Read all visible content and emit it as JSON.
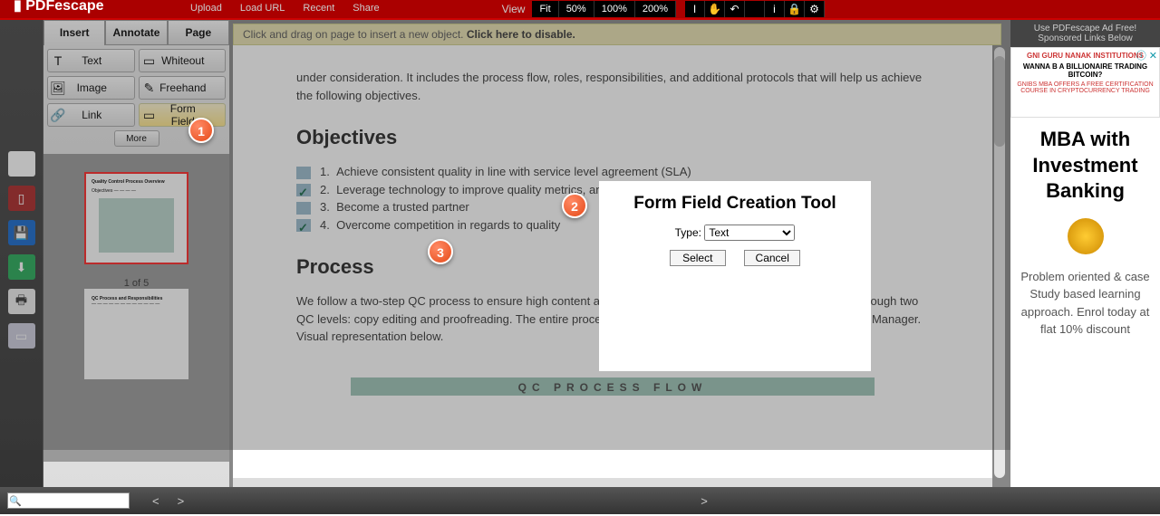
{
  "topbar": {
    "logo": "PDFescape",
    "menu": [
      "Upload",
      "Load URL",
      "Recent",
      "Share"
    ],
    "view_label": "View",
    "zoom": [
      "Fit",
      "50%",
      "100%",
      "200%"
    ],
    "icons": [
      "text-cursor-icon",
      "hand-icon",
      "undo-icon",
      "redo-icon",
      "info-icon",
      "lock-icon",
      "gear-icon"
    ]
  },
  "tabs": {
    "insert": "Insert",
    "annotate": "Annotate",
    "page": "Page"
  },
  "tools": {
    "text": "Text",
    "whiteout": "Whiteout",
    "image": "Image",
    "freehand": "Freehand",
    "link": "Link",
    "formfield": "Form Field",
    "more": "More"
  },
  "thumbs": {
    "page1_label": "1 of 5",
    "page1_title": "Quality Control Process Overview"
  },
  "hint": {
    "pre": "Click and drag on page to insert a new object. ",
    "bold": "Click here to disable."
  },
  "doc": {
    "intro_tail": "under consideration. It includes the process flow, roles, responsibilities, and additional protocols that will help us achieve the following objectives.",
    "h_objectives": "Objectives",
    "obj1": "Achieve consistent quality in line with service level agreement (SLA)",
    "obj2": "Leverage technology to improve quality metrics, and deliver a superior customer experience",
    "obj3": "Become a trusted partner",
    "obj4": "Overcome competition in regards to quality",
    "h_process": "Process",
    "process_para": "We follow a two-step QC process to ensure high content accuracy & consistency. Each writer's work will go through two QC levels: copy editing and proofreading. The entire process will be owned and overseen by a Quality Control Manager. Visual representation below.",
    "qc_banner": "QC PROCESS FLOW"
  },
  "modal": {
    "title": "Form Field Creation Tool",
    "type_label": "Type:",
    "type_value": "Text",
    "select": "Select",
    "cancel": "Cancel"
  },
  "ads": {
    "line1": "Use PDFescape Ad Free!",
    "line2": "Sponsored Links Below",
    "banner_top": "GNI GURU NANAK INSTITUTIONS",
    "banner_q": "WANNA B A BILLIONAIRE TRADING BITCOIN?",
    "banner_sub": "GNIBS MBA OFFERS A FREE CERTIFICATION COURSE IN CRYPTOCURRENCY TRADING",
    "main_title": "MBA with Investment Banking",
    "main_text": "Problem oriented & case Study based learning approach. Enrol today at flat 10% discount"
  },
  "footer": {
    "prev": "<",
    "next": ">",
    "next2": ">"
  },
  "markers": {
    "m1": "1",
    "m2": "2",
    "m3": "3"
  }
}
